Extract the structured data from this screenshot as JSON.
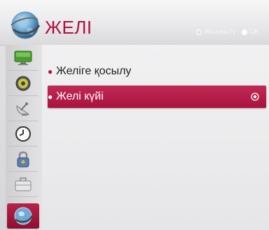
{
  "header": {
    "title": "ЖЕЛІ",
    "icon": "network-globe-icon",
    "hints": [
      {
        "icon": "move-icon",
        "label": "Жылжыту"
      },
      {
        "icon": "ok-button-icon",
        "label": "OK"
      }
    ]
  },
  "sidebar": {
    "items": [
      {
        "icon": "picture-icon",
        "active": false
      },
      {
        "icon": "sound-icon",
        "active": false
      },
      {
        "icon": "channel-dish-icon",
        "active": false
      },
      {
        "icon": "time-icon",
        "active": false
      },
      {
        "icon": "lock-icon",
        "active": false
      },
      {
        "icon": "option-briefcase-icon",
        "active": false
      },
      {
        "icon": "network-globe-icon",
        "active": true
      }
    ]
  },
  "menu": {
    "items": [
      {
        "label": "Желіге қосылу",
        "selected": false
      },
      {
        "label": "Желі күйі",
        "selected": true
      }
    ]
  },
  "colors": {
    "accent": "#b0123c",
    "selected_bg": "#b51d49"
  }
}
